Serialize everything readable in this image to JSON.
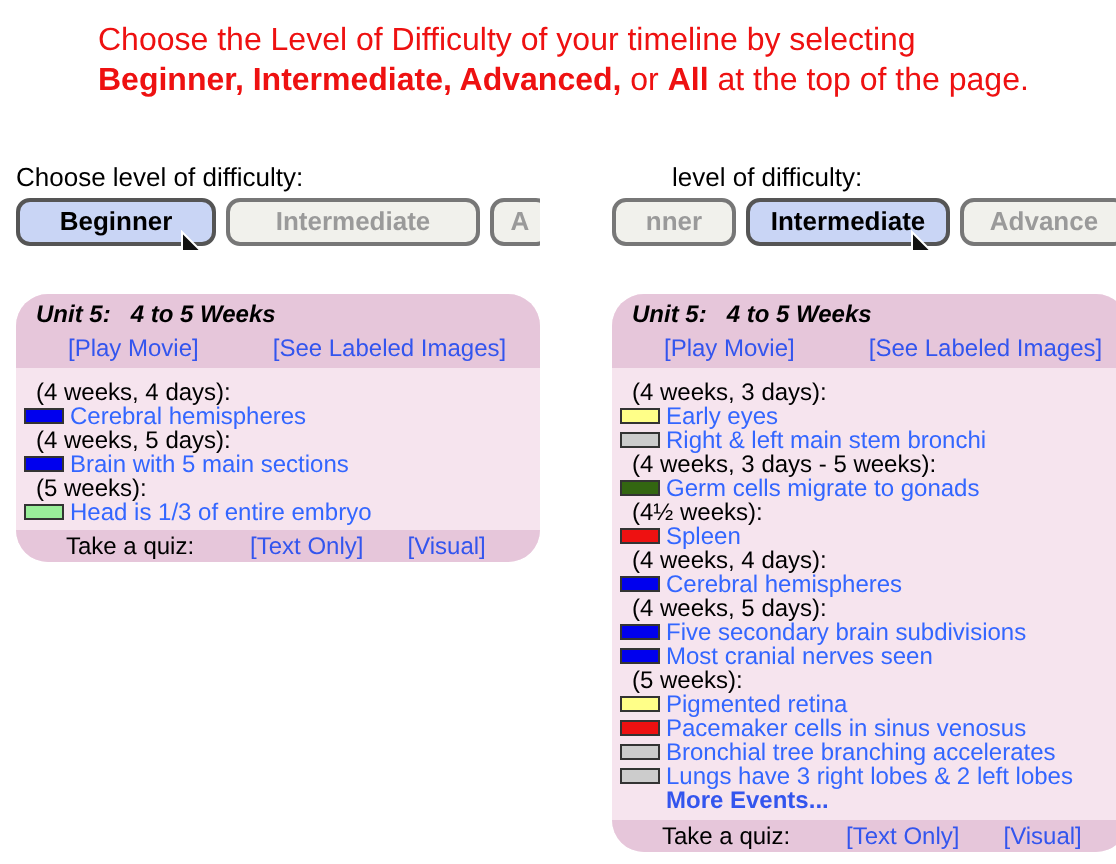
{
  "heading": [
    "Choose the Level of Difficulty of your timeline by selecting",
    "**Beginner, Intermediate, Advanced,** or **All** at the top of the page."
  ],
  "panels": [
    {
      "label": "Choose level of difficulty:",
      "levels": [
        {
          "text": "Beginner",
          "selected": true
        },
        {
          "text": "Intermediate",
          "selected": false
        },
        {
          "text": "A",
          "selected": false
        }
      ],
      "unit": "Unit 5:   4 to 5 Weeks",
      "links": [
        "[Play Movie]",
        "[See Labeled Images]"
      ],
      "entries": [
        {
          "kind": "time",
          "text": "(4 weeks, 4 days):"
        },
        {
          "kind": "event",
          "text": "Cerebral hemispheres",
          "color": "#0000ee"
        },
        {
          "kind": "time",
          "text": "(4 weeks, 5 days):"
        },
        {
          "kind": "event",
          "text": "Brain with 5 main sections",
          "color": "#0000ee"
        },
        {
          "kind": "time",
          "text": "(5 weeks):"
        },
        {
          "kind": "event",
          "text": "Head is 1/3 of entire embryo",
          "color": "#99ee99"
        }
      ],
      "quiz": {
        "label": "Take a quiz:",
        "links": [
          "[Text Only]",
          "[Visual]"
        ]
      }
    },
    {
      "label": "level of difficulty:",
      "levels": [
        {
          "text": "nner",
          "selected": false
        },
        {
          "text": "Intermediate",
          "selected": true
        },
        {
          "text": "Advance",
          "selected": false
        }
      ],
      "unit": "Unit 5:   4 to 5 Weeks",
      "links": [
        "[Play Movie]",
        "[See Labeled Images]"
      ],
      "entries": [
        {
          "kind": "time",
          "text": "(4 weeks, 3 days):"
        },
        {
          "kind": "event",
          "text": "Early eyes",
          "color": "#ffff88"
        },
        {
          "kind": "event",
          "text": "Right & left main stem bronchi",
          "color": "#cccccc"
        },
        {
          "kind": "time",
          "text": "(4 weeks, 3 days - 5 weeks):"
        },
        {
          "kind": "event",
          "text": "Germ cells migrate to gonads",
          "color": "#336611"
        },
        {
          "kind": "time",
          "text": "(4½ weeks):"
        },
        {
          "kind": "event",
          "text": "Spleen",
          "color": "#ee1111"
        },
        {
          "kind": "time",
          "text": "(4 weeks, 4 days):"
        },
        {
          "kind": "event",
          "text": "Cerebral hemispheres",
          "color": "#0000ee"
        },
        {
          "kind": "time",
          "text": "(4 weeks, 5 days):"
        },
        {
          "kind": "event",
          "text": "Five secondary brain subdivisions",
          "color": "#0000ee"
        },
        {
          "kind": "event",
          "text": "Most cranial nerves seen",
          "color": "#0000ee"
        },
        {
          "kind": "time",
          "text": "(5 weeks):"
        },
        {
          "kind": "event",
          "text": "Pigmented retina",
          "color": "#ffff88"
        },
        {
          "kind": "event",
          "text": "Pacemaker cells in sinus venosus",
          "color": "#ee1111"
        },
        {
          "kind": "event",
          "text": "Bronchial tree branching accelerates",
          "color": "#cccccc"
        },
        {
          "kind": "event",
          "text": "Lungs have 3 right lobes & 2 left lobes",
          "color": "#cccccc"
        },
        {
          "kind": "more",
          "text": "More Events..."
        }
      ],
      "quiz": {
        "label": "Take a quiz:",
        "links": [
          "[Text Only]",
          "[Visual]"
        ]
      }
    }
  ]
}
